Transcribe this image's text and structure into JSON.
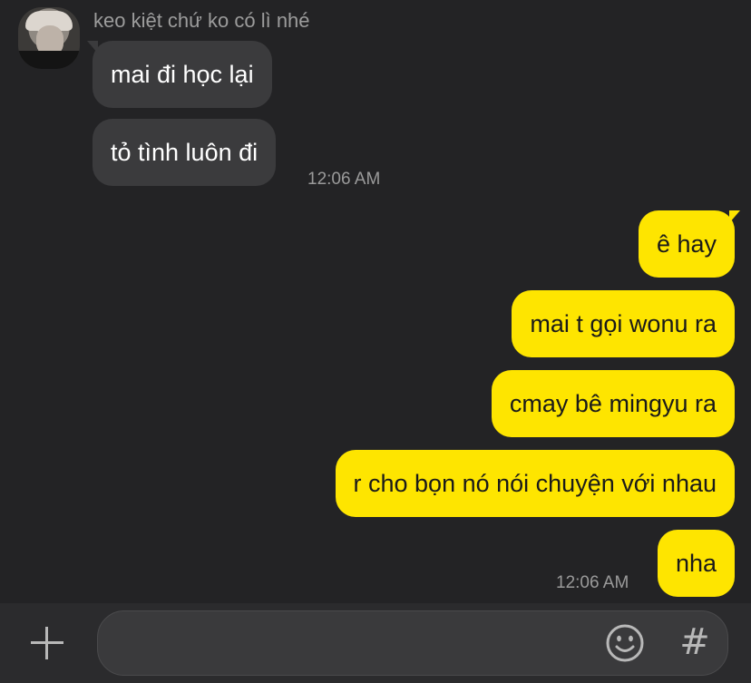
{
  "chat": {
    "sender_name": "keo kiệt chứ ko có lì nhé",
    "incoming": [
      {
        "text": "mai đi học lại"
      },
      {
        "text": "tỏ tình luôn đi"
      }
    ],
    "incoming_time": "12:06 AM",
    "outgoing": [
      {
        "text": "ê hay"
      },
      {
        "text": "mai t gọi wonu ra"
      },
      {
        "text": "cmay bê mingyu ra"
      },
      {
        "text": "r cho bọn nó nói chuyện với nhau"
      },
      {
        "text": "nha"
      }
    ],
    "outgoing_time": "12:06 AM"
  },
  "input_bar": {
    "message_value": "",
    "icons": {
      "add": "plus-icon",
      "emoji": "smiley-icon",
      "hashtag": "hash-icon"
    },
    "hash_glyph": "#"
  },
  "colors": {
    "background": "#232325",
    "incoming_bubble": "#3b3b3d",
    "outgoing_bubble": "#fee500"
  }
}
